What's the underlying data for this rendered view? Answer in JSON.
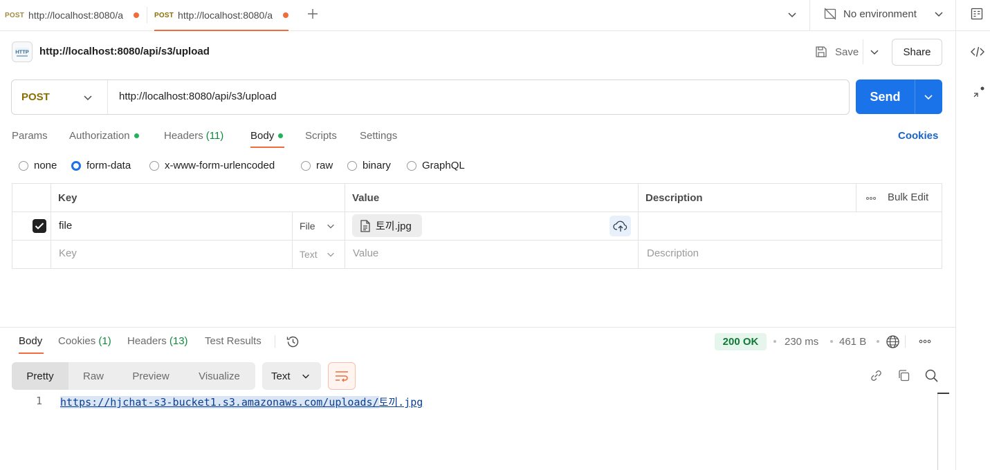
{
  "tabs": [
    {
      "method": "POST",
      "url": "http://localhost:8080/a",
      "active": false
    },
    {
      "method": "POST",
      "url": "http://localhost:8080/a",
      "active": true
    }
  ],
  "environment": {
    "label": "No environment"
  },
  "request": {
    "title": "http://localhost:8080/api/s3/upload",
    "icon_label": "HTTP",
    "save_label": "Save",
    "share_label": "Share",
    "method": "POST",
    "url": "http://localhost:8080/api/s3/upload",
    "send_label": "Send"
  },
  "request_tabs": [
    {
      "label": "Params",
      "count": "",
      "dot": false
    },
    {
      "label": "Authorization",
      "count": "",
      "dot": true
    },
    {
      "label": "Headers",
      "count": "(11)",
      "dot": false
    },
    {
      "label": "Body",
      "count": "",
      "dot": true,
      "active": true
    },
    {
      "label": "Scripts",
      "count": "",
      "dot": false
    },
    {
      "label": "Settings",
      "count": "",
      "dot": false
    }
  ],
  "cookies_link": "Cookies",
  "body_types": [
    {
      "label": "none",
      "selected": false
    },
    {
      "label": "form-data",
      "selected": true
    },
    {
      "label": "x-www-form-urlencoded",
      "selected": false
    },
    {
      "label": "raw",
      "selected": false
    },
    {
      "label": "binary",
      "selected": false
    },
    {
      "label": "GraphQL",
      "selected": false
    }
  ],
  "table": {
    "headers": {
      "key": "Key",
      "value": "Value",
      "description": "Description",
      "bulk_edit": "Bulk Edit"
    },
    "rows": [
      {
        "checked": true,
        "key": "file",
        "type": "File",
        "value": "토끼.jpg",
        "description": ""
      }
    ],
    "empty_row": {
      "key": "Key",
      "type": "Text",
      "value": "Value",
      "description": "Description"
    }
  },
  "response": {
    "tabs": [
      {
        "label": "Body",
        "count": "",
        "active": true
      },
      {
        "label": "Cookies",
        "count": "(1)"
      },
      {
        "label": "Headers",
        "count": "(13)"
      },
      {
        "label": "Test Results",
        "count": ""
      }
    ],
    "status": "200 OK",
    "time": "230 ms",
    "size": "461 B",
    "view_modes": [
      "Pretty",
      "Raw",
      "Preview",
      "Visualize"
    ],
    "selected_view": "Pretty",
    "format": "Text",
    "lines": [
      {
        "number": "1",
        "url_prefix": "https://hjchat-s3-bucket1.s3.amazonaws.com/uploads/",
        "url_suffix": "토끼.jpg"
      }
    ]
  },
  "colors": {
    "accent": "#f26b3a",
    "send": "#1a73e8",
    "method": "#8a6d00",
    "status_ok": "#0f7a36"
  }
}
